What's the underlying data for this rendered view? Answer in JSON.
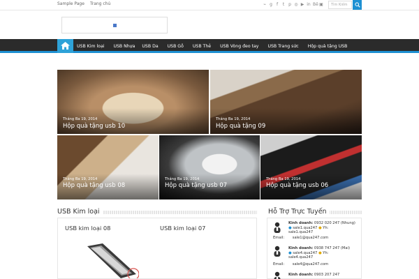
{
  "topbar": {
    "links": [
      "Sample Page",
      "Trang chủ"
    ],
    "social_icons": [
      "rss-icon",
      "google-plus-icon",
      "facebook-icon",
      "twitter-icon",
      "pinterest-icon",
      "dribbble-icon",
      "youtube-icon",
      "linkedin-icon",
      "behance-icon",
      "instagram-icon"
    ],
    "social_glyphs": [
      "⌁",
      "g",
      "f",
      "t",
      "p",
      "◎",
      "▶",
      "in",
      "Bē",
      "▣"
    ],
    "search_placeholder": "Tìm Kiếm"
  },
  "nav": {
    "items": [
      "USB Kim loại",
      "USB Nhựa",
      "USB Da",
      "USB Gỗ",
      "USB Thẻ",
      "USB Vòng đeo tay",
      "USB Trang sức",
      "Hộp quà tặng USB"
    ]
  },
  "featured": [
    {
      "date": "Tháng Ba 19, 2014",
      "title": "Hộp quà tặng usb 10"
    },
    {
      "date": "Tháng Ba 19, 2014",
      "title": "Hộp quà tặng 09"
    },
    {
      "date": "Tháng Ba 19, 2014",
      "title": "Hộp quà tặng usb 08"
    },
    {
      "date": "Tháng Ba 19, 2014",
      "title": "Hộp quà tặng usb 07"
    },
    {
      "date": "Tháng Ba 19, 2014",
      "title": "Hộp quà tặng usb 06"
    }
  ],
  "section_usb": {
    "heading": "USB Kim loại",
    "posts": [
      "USB kim loại 08",
      "USB kim loại 07"
    ]
  },
  "support": {
    "heading": "Hỗ Trợ Trực Tuyến",
    "contacts": [
      {
        "label": "Kinh doanh:",
        "phone": "0932 020 247 (Nhung)",
        "skype": "sale1.qua247",
        "yahoo": "Yh:",
        "yahoo_id": "sale1.qua247",
        "email_label": "Email:",
        "email": "sale1@qua247.com"
      },
      {
        "label": "Kinh doanh:",
        "phone": "0938 747 247 (Mai)",
        "skype": "sale4.qua247",
        "yahoo": "Yh:",
        "yahoo_id": "sale4.qua247",
        "email_label": "Email:",
        "email": "sale4@qua247.com"
      },
      {
        "label": "Kinh doanh:",
        "phone": "0903 207 247"
      }
    ]
  },
  "colors": {
    "accent": "#1e90d2",
    "nav_bg": "#2b2b2b"
  }
}
